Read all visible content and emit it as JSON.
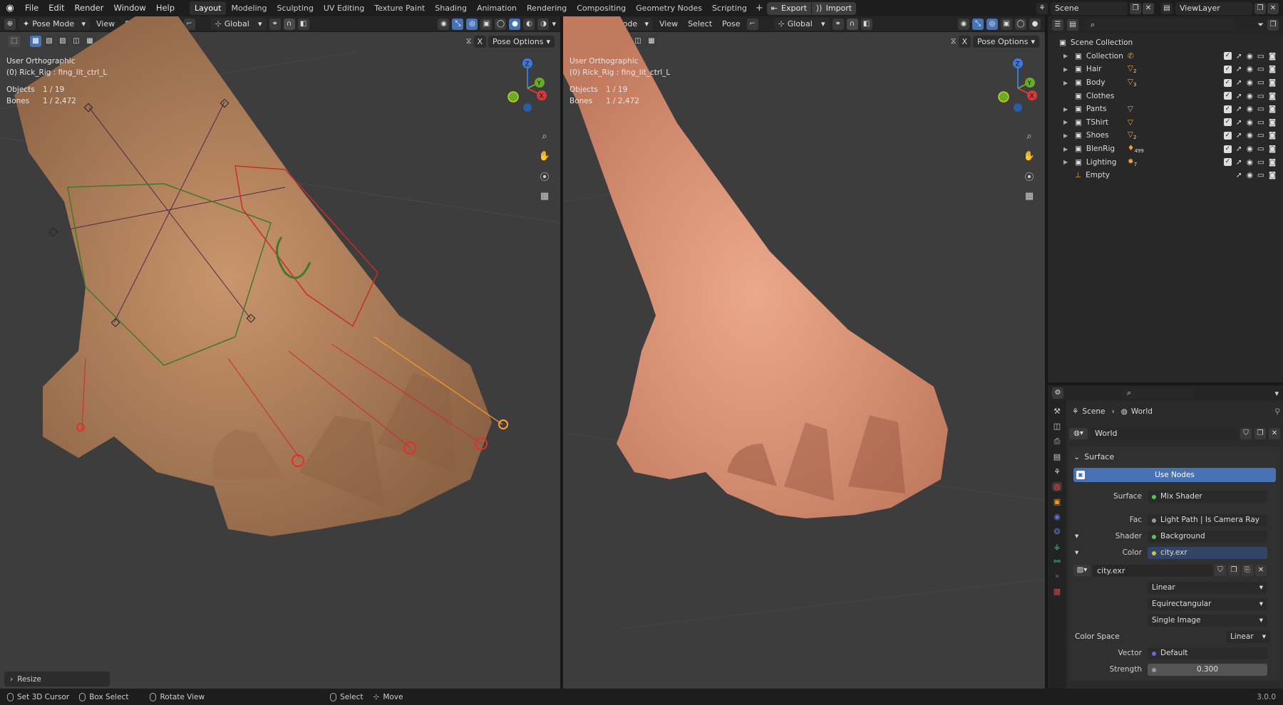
{
  "topbar": {
    "menus": [
      "File",
      "Edit",
      "Render",
      "Window",
      "Help"
    ],
    "workspaces": [
      "Layout",
      "Modeling",
      "Sculpting",
      "UV Editing",
      "Texture Paint",
      "Shading",
      "Animation",
      "Rendering",
      "Compositing",
      "Geometry Nodes",
      "Scripting"
    ],
    "active_workspace": "Layout",
    "export_label": "Export",
    "import_label": "Import",
    "scene": "Scene",
    "view_layer": "ViewLayer"
  },
  "viewport_header": {
    "mode": "Pose Mode",
    "menus": [
      "View",
      "Select",
      "Pose"
    ],
    "orientation": "Global",
    "pose_options": "Pose Options",
    "x_label": "X"
  },
  "viewport_left": {
    "view": "User Orthographic",
    "object": "(0) Rick_Rig : fing_lit_ctrl_L",
    "objects_label": "Objects",
    "objects_value": "1 / 19",
    "bones_label": "Bones",
    "bones_value": "1 / 2,472",
    "operator": "Resize"
  },
  "viewport_right": {
    "view": "User Orthographic",
    "object": "(0) Rick_Rig : fing_lit_ctrl_L",
    "objects_label": "Objects",
    "objects_value": "1 / 19",
    "bones_label": "Bones",
    "bones_value": "1 / 2,472"
  },
  "gizmo": {
    "z": "Z",
    "y": "Y",
    "x": "X"
  },
  "outliner": {
    "root": "Scene Collection",
    "items": [
      {
        "name": "Collection",
        "badge": "",
        "icon": "camera-icon"
      },
      {
        "name": "Hair",
        "badge": "2",
        "icon": "mesh-icon"
      },
      {
        "name": "Body",
        "badge": "3",
        "icon": "mesh-icon"
      },
      {
        "name": "Clothes",
        "badge": "",
        "icon": ""
      },
      {
        "name": "Pants",
        "badge": "",
        "icon": "mesh-icon"
      },
      {
        "name": "TShirt",
        "badge": "",
        "icon": "mesh-icon"
      },
      {
        "name": "Shoes",
        "badge": "2",
        "icon": "mesh-icon"
      },
      {
        "name": "BlenRig",
        "badge": "499",
        "icon": "armature-icon"
      },
      {
        "name": "Lighting",
        "badge": "7",
        "icon": "light-icon"
      },
      {
        "name": "Empty",
        "badge": "",
        "icon": "empty-icon"
      }
    ]
  },
  "properties": {
    "breadcrumb_scene": "Scene",
    "breadcrumb_world": "World",
    "world_name": "World",
    "panel_surface": "Surface",
    "use_nodes": "Use Nodes",
    "rows": [
      {
        "label": "Surface",
        "value": "Mix Shader",
        "dot": "#5fbf5f"
      },
      {
        "label": "Fac",
        "value": "Light Path | Is Camera Ray",
        "dot": "#9a9a9a"
      },
      {
        "label": "Shader",
        "value": "Background",
        "dot": "#5fbf5f"
      },
      {
        "label": "Color",
        "value": "city.exr",
        "dot": "#c8c83a"
      }
    ],
    "image_name": "city.exr",
    "interp": "Linear",
    "projection": "Equirectangular",
    "source": "Single Image",
    "color_space_label": "Color Space",
    "color_space": "Linear",
    "vector_label": "Vector",
    "vector_value": "Default",
    "strength_label": "Strength",
    "strength_value": "0.300"
  },
  "statusbar": {
    "items": [
      "Set 3D Cursor",
      "Box Select",
      "Rotate View",
      "Select",
      "Move"
    ],
    "version": "3.0.0"
  }
}
